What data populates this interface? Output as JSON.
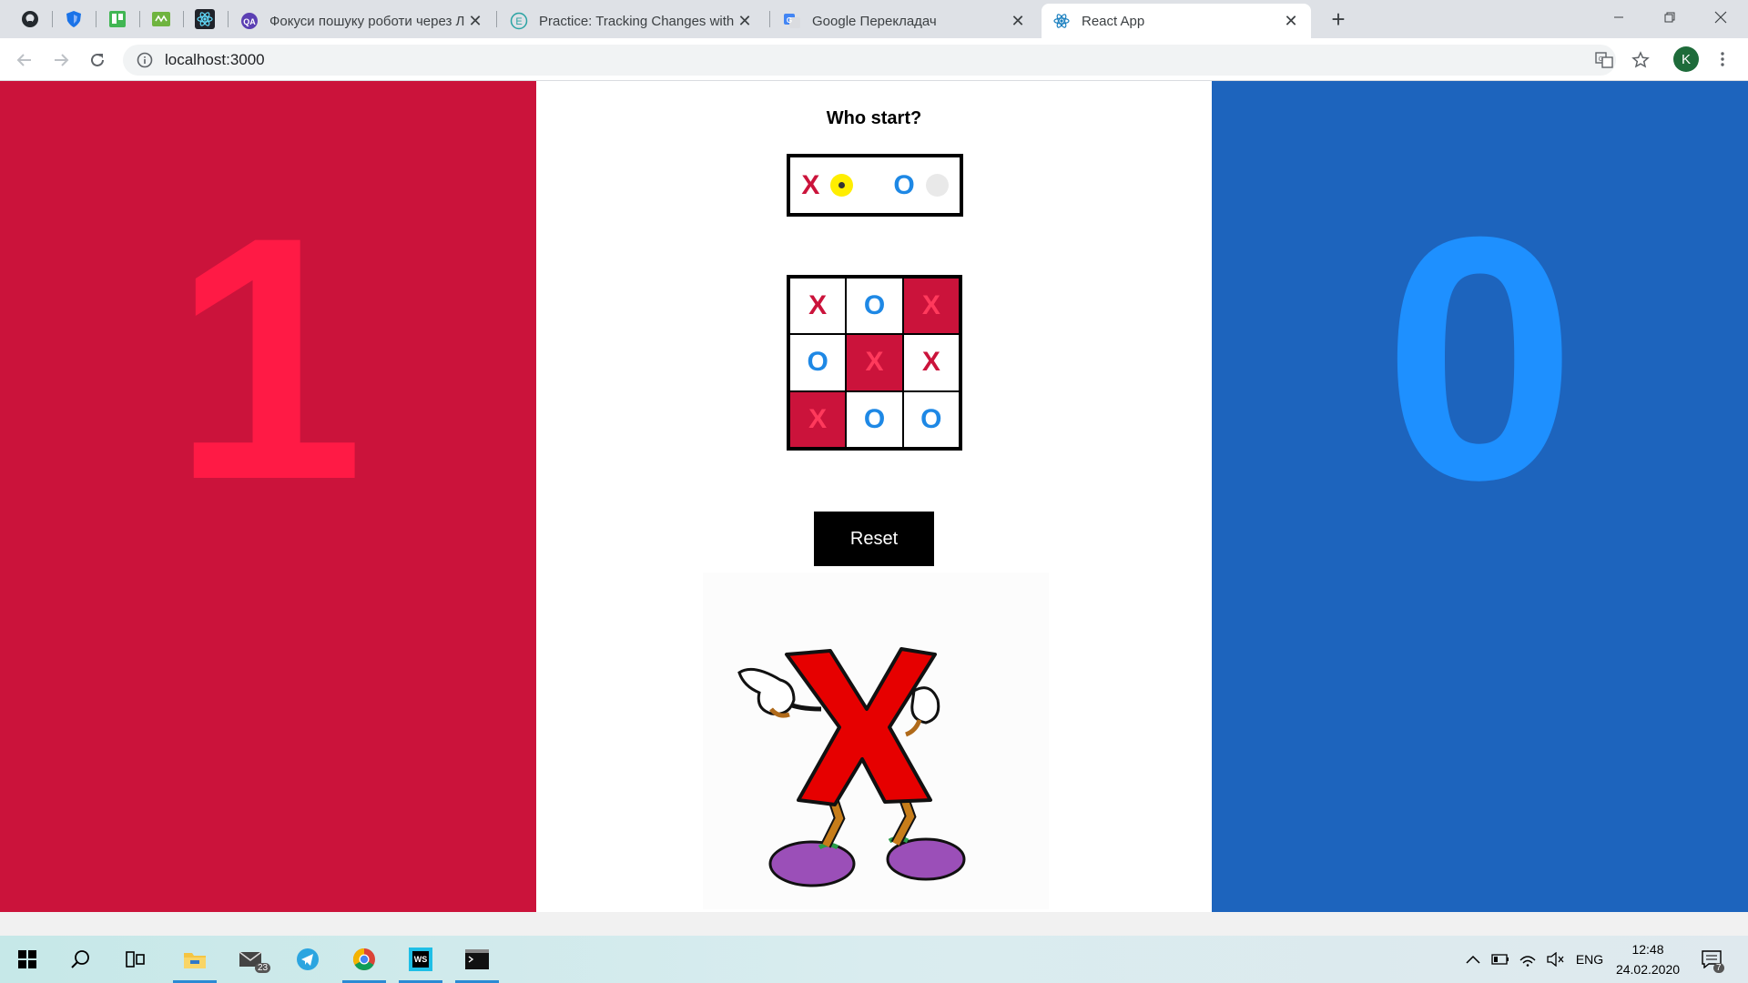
{
  "browser": {
    "tabs": [
      {
        "title": "Фокуси пошуку роботи через Л",
        "favicon": "qa-icon"
      },
      {
        "title": "Practice: Tracking Changes with C",
        "favicon": "e-icon"
      },
      {
        "title": "Google Перекладач",
        "favicon": "google-translate-icon"
      },
      {
        "title": "React App",
        "favicon": "react-icon",
        "active": true
      }
    ],
    "url": "localhost:3000",
    "profile_initial": "K"
  },
  "game": {
    "score_x": "1",
    "score_o": "0",
    "who_start_label": "Who start?",
    "x_symbol": "X",
    "o_symbol": "O",
    "selected_starter": "X",
    "board": [
      {
        "mark": "X",
        "win": false
      },
      {
        "mark": "O",
        "win": false
      },
      {
        "mark": "X",
        "win": true
      },
      {
        "mark": "O",
        "win": false
      },
      {
        "mark": "X",
        "win": true
      },
      {
        "mark": "X",
        "win": false
      },
      {
        "mark": "X",
        "win": true
      },
      {
        "mark": "O",
        "win": false
      },
      {
        "mark": "O",
        "win": false
      }
    ],
    "reset_label": "Reset",
    "colors": {
      "x_panel": "#cb133b",
      "o_panel": "#1d64bd",
      "x_mark": "#cb133b",
      "o_mark": "#1e88e5"
    }
  },
  "taskbar": {
    "mail_badge": "23",
    "language": "ENG",
    "time": "12:48",
    "date": "24.02.2020",
    "notifications": "7"
  }
}
